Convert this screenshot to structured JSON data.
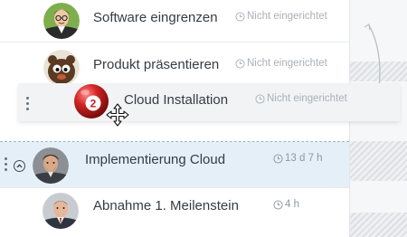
{
  "tasks": [
    {
      "title": "Software eingrenzen",
      "status": "Nicht eingerichtet",
      "avatar": "man-with-glasses-avatar"
    },
    {
      "title": "Produkt präsentieren",
      "status": "Nicht eingerichtet",
      "avatar": "cartoon-character-avatar"
    },
    {
      "title": "Cloud Installation",
      "status": "Nicht eingerichtet",
      "avatar": "red-ball-avatar",
      "avatar_number": "2",
      "state": "dragging"
    },
    {
      "title": "Implementierung Cloud",
      "status": "13 d 7 h",
      "avatar": "bearded-man-avatar",
      "state": "expanded"
    },
    {
      "title": "Abnahme 1. Meilenstein",
      "status": "4 h",
      "avatar": "man-in-suit-avatar"
    }
  ],
  "icons": {
    "status": "clock-icon",
    "drag": "drag-handle-icon",
    "collapse": "chevron-up-circle-icon",
    "cursor": "move-cursor-icon",
    "gutter": "curved-double-arrow-icon"
  },
  "colors": {
    "highlight_row": "#e4eff7",
    "text": "#333d45",
    "status_text": "#a9b1b8",
    "drag_card": "#f2f3f4",
    "ball_red": "#c81e1e"
  }
}
